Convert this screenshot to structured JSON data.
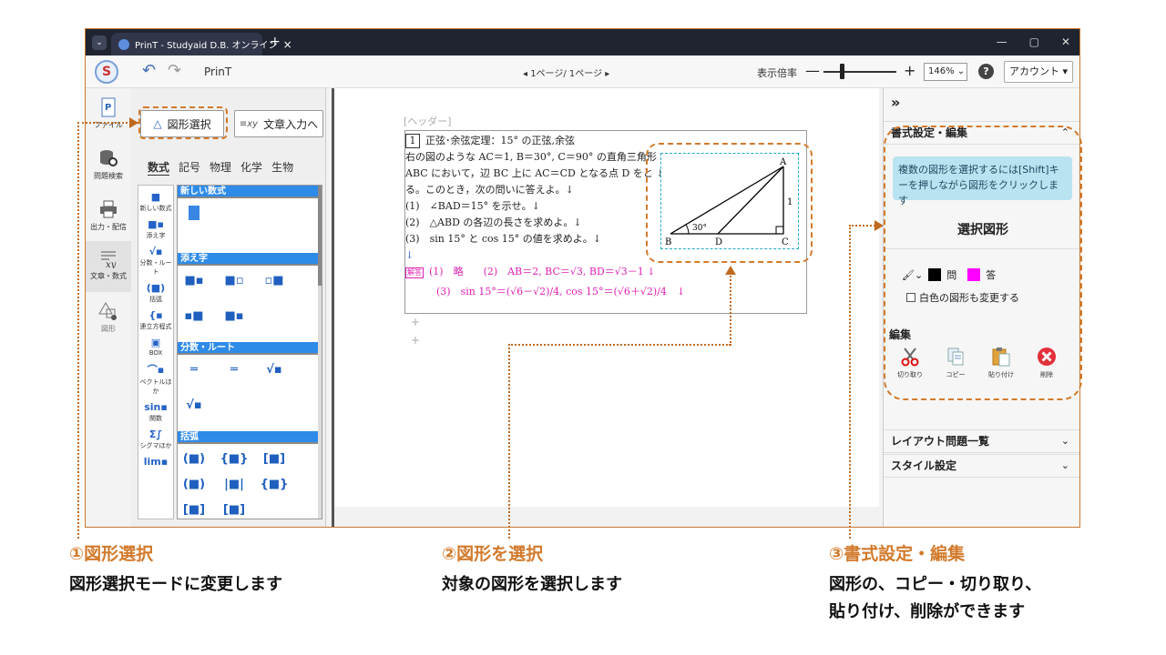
{
  "window": {
    "tab_title": "PrinT - Studyaid D.B. オンライン",
    "tab_close": "×",
    "new_tab": "+",
    "chevron": "⌄",
    "win_buttons": [
      "—",
      "▢",
      "✕"
    ]
  },
  "toolbar": {
    "app_name": "PrinT",
    "pager": "◂ 1ページ/ 1ページ ▸",
    "zoom_label": "表示倍率",
    "zoom_minus": "—",
    "zoom_plus": "+",
    "zoom_value": "146%",
    "zoom_fraction": 0.25,
    "help": "?",
    "account": "アカウント ▾"
  },
  "rail": {
    "items": [
      {
        "label": "ファイル",
        "icon": "file-icon"
      },
      {
        "label": "問題検索",
        "icon": "database-icon"
      },
      {
        "label": "出力・配信",
        "icon": "printer-icon"
      },
      {
        "label": "文章・数式",
        "icon": "formula-icon"
      },
      {
        "label": "図形",
        "icon": "shapes-icon"
      }
    ]
  },
  "palette": {
    "shape_select_button": "図形選択",
    "text_input_button": "文章入力へ",
    "categories": [
      "数式",
      "記号",
      "物理",
      "化学",
      "生物"
    ],
    "active_category": "数式",
    "subcategories": [
      {
        "label": "新しい数式",
        "glyph": "■"
      },
      {
        "label": "添え字",
        "glyph": "■▪"
      },
      {
        "label": "分数・ルート",
        "glyph": "√▪"
      },
      {
        "label": "括弧",
        "glyph": "(■)"
      },
      {
        "label": "連立方程式",
        "glyph": "{▪"
      },
      {
        "label": "BOX",
        "glyph": "▣"
      },
      {
        "label": "ベクトルほか",
        "glyph": "⌒▪"
      },
      {
        "label": "関数",
        "glyph": "sin▪"
      },
      {
        "label": "シグマほか",
        "glyph": "Σ∫"
      },
      {
        "label": "",
        "glyph": "lim▪"
      }
    ],
    "sections": [
      {
        "title": "新しい数式",
        "items": [
          "■"
        ]
      },
      {
        "title": "添え字",
        "items": [
          "■▪",
          "■▫",
          "▫■",
          "▪■",
          "■▪"
        ]
      },
      {
        "title": "分数・ルート",
        "items": [
          "═",
          "═",
          "√▪",
          "√▪"
        ]
      },
      {
        "title": "括弧",
        "items": [
          "(■)",
          "{■}",
          "[■]",
          "(■)",
          "|■|",
          "{■}",
          "[■]",
          "[■]"
        ]
      }
    ]
  },
  "document": {
    "header_placeholder": "[ヘッダー]",
    "problem_number": "1",
    "problem_title": "正弦･余弦定理：15° の正弦,余弦",
    "lines": [
      "右の図のような AC＝1,  B＝30°,  C＝90° の直角三角形 ↓",
      "ABC において，辺 BC 上に AC＝CD となる点 D をと ↓",
      "る。このとき，次の問いに答えよ。↓",
      "(1)　∠BAD＝15° を示せ。↓",
      "(2)　△ABD の各辺の長さを求めよ。↓",
      "(3)　sin 15° と cos 15° の値を求めよ。↓",
      "↓"
    ],
    "answer_tag": "解答",
    "answer_line1": "(1)　略　　(2)　AB＝2,  BC＝√3,  BD＝√3－1 ↓",
    "answer_line2": "(3)　sin 15°＝(√6－√2)/4,  cos 15°＝(√6＋√2)/4　↓",
    "plus": "+",
    "figure": {
      "vertex_a": "A",
      "vertex_b": "B",
      "vertex_c": "C",
      "vertex_d": "D",
      "angle_label": "30°",
      "side_label": "1"
    }
  },
  "right_panel": {
    "expand": "»",
    "format_section": "書式設定・編集",
    "info_text": "複数の図形を選択するには[Shift]キーを押しながら図形をクリックします",
    "selected_title": "選択図形",
    "color_q_label": "問",
    "color_a_label": "答",
    "color_q": "#000000",
    "color_a": "#ff00ff",
    "white_shapes_option": "白色の図形も変更する",
    "edit_label": "編集",
    "tools": [
      {
        "label": "切り取り",
        "icon": "scissors-icon"
      },
      {
        "label": "コピー",
        "icon": "copy-icon"
      },
      {
        "label": "貼り付け",
        "icon": "paste-icon"
      },
      {
        "label": "削除",
        "icon": "delete-icon"
      }
    ],
    "layout_section": "レイアウト問題一覧",
    "style_section": "スタイル設定",
    "chevron_up": "⌃",
    "chevron_down": "⌄"
  },
  "captions": [
    {
      "title": "①図形選択",
      "desc": "図形選択モードに変更します"
    },
    {
      "title": "②図形を選択",
      "desc": "対象の図形を選択します"
    },
    {
      "title": "③書式設定・編集",
      "desc_line1": "図形の、コピー・切り取り、",
      "desc_line2": "貼り付け、削除ができます"
    }
  ],
  "colors": {
    "accent_orange": "#d27a2c",
    "palette_header": "#2f8be8",
    "answer_magenta": "#e01fb3",
    "info_box": "#b9e3f0"
  }
}
